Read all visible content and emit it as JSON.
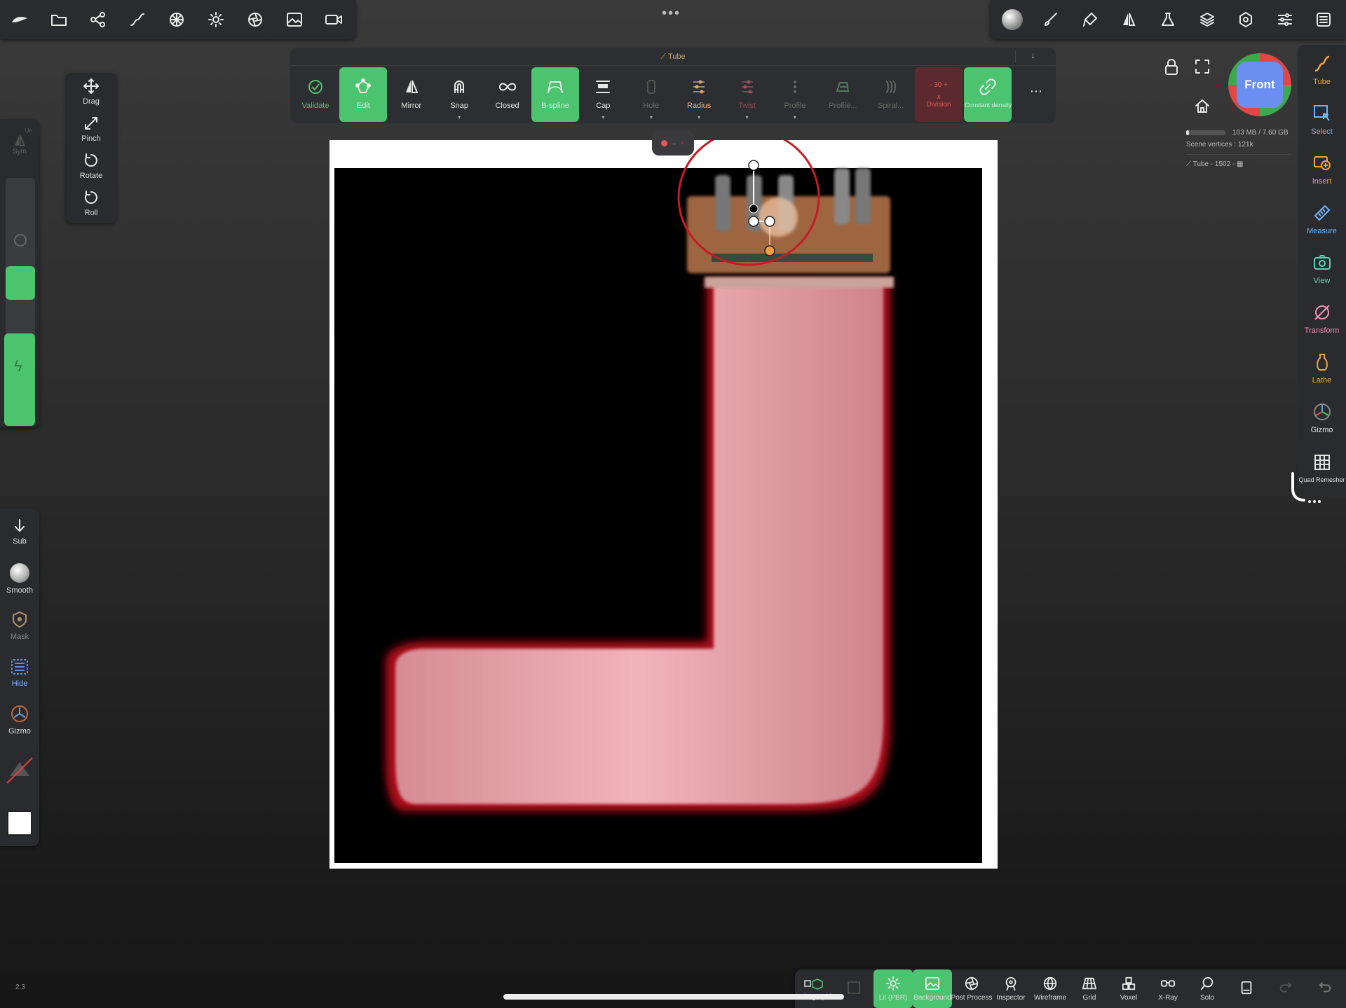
{
  "top_left_toolbar": [
    "logo-icon",
    "folder-icon",
    "scene-share-icon",
    "curve-tool-icon",
    "sphere-grid-icon",
    "sun-icon",
    "aperture-icon",
    "image-icon",
    "camera-icon"
  ],
  "top_center": {
    "dots": "•••"
  },
  "top_right_toolbar": [
    "material-ball-icon",
    "brush-icon",
    "paint-icon",
    "mirror-icon",
    "flask-icon",
    "layers-icon",
    "settings-gear-icon",
    "sliders-icon",
    "menu-icon"
  ],
  "tool_bar": {
    "title": "Tube",
    "collapse_label": "↓",
    "buttons": [
      {
        "label": "Validate",
        "state": "off"
      },
      {
        "label": "Edit",
        "state": "on"
      },
      {
        "label": "Mirror",
        "state": "off"
      },
      {
        "label": "Snap",
        "state": "off"
      },
      {
        "label": "Closed",
        "state": "off"
      },
      {
        "label": "B-spline",
        "state": "on"
      },
      {
        "label": "Cap",
        "state": "off"
      },
      {
        "label": "Hole",
        "state": "dim"
      },
      {
        "label": "Radius",
        "state": "off"
      },
      {
        "label": "Twist",
        "state": "dim"
      },
      {
        "label": "Profile",
        "state": "dim"
      },
      {
        "label": "Profile...",
        "state": "dim"
      },
      {
        "label": "Spiral...",
        "state": "dim"
      }
    ],
    "division": {
      "value": "30",
      "label": "Division",
      "x": "x"
    },
    "constant_density_label": "Constant density",
    "more_label": "⋯"
  },
  "left_transform": [
    {
      "label": "Drag",
      "icon": "drag-arrows-icon"
    },
    {
      "label": "Pinch",
      "icon": "pinch-icon"
    },
    {
      "label": "Rotate",
      "icon": "rotate-icon"
    },
    {
      "label": "Roll",
      "icon": "roll-icon"
    }
  ],
  "left_strip": {
    "sym_label": "Sym",
    "sym_sub": "Un"
  },
  "left_brushes": [
    {
      "label": "Sub",
      "style": "white"
    },
    {
      "label": "Smooth",
      "style": "white"
    },
    {
      "label": "Mask",
      "style": "gray"
    },
    {
      "label": "Hide",
      "style": "blue"
    },
    {
      "label": "Gizmo",
      "style": "white"
    }
  ],
  "right_tools": [
    {
      "label": "Tube",
      "color": "orange"
    },
    {
      "label": "Select",
      "color": "blue"
    },
    {
      "label": "Insert",
      "color": "orange"
    },
    {
      "label": "Measure",
      "color": "blue"
    },
    {
      "label": "View",
      "color": "green"
    },
    {
      "label": "Transform",
      "color": "pink"
    },
    {
      "label": "Lathe",
      "color": "orange"
    },
    {
      "label": "Gizmo",
      "color": "white"
    },
    {
      "label": "Quad Remesher",
      "color": "white"
    }
  ],
  "view_cube": {
    "label": "Front"
  },
  "stats": {
    "memory": "103 MB / 7.60 GB",
    "vertices": "Scene vertices : 121k",
    "object": "Tube - 1502 -"
  },
  "bottom_bar": [
    {
      "label": "Orthographic",
      "state": "off"
    },
    {
      "label": "",
      "state": "dim"
    },
    {
      "label": "Lit (PBR)",
      "state": "on"
    },
    {
      "label": "Background",
      "state": "on"
    },
    {
      "label": "Post Process",
      "state": "off"
    },
    {
      "label": "Inspector",
      "state": "off"
    },
    {
      "label": "Wireframe",
      "state": "off"
    },
    {
      "label": "Grid",
      "state": "off"
    },
    {
      "label": "Voxel",
      "state": "off"
    },
    {
      "label": "X-Ray",
      "state": "off"
    },
    {
      "label": "Solo",
      "state": "off"
    },
    {
      "label": "",
      "state": "off"
    },
    {
      "label": "",
      "state": "dim"
    },
    {
      "label": "",
      "state": "dim"
    }
  ],
  "version": "2.3",
  "colors": {
    "accent_green": "#4cc46f",
    "tube_pink": "#e8a0a8",
    "outline_red": "#d10d1a"
  }
}
